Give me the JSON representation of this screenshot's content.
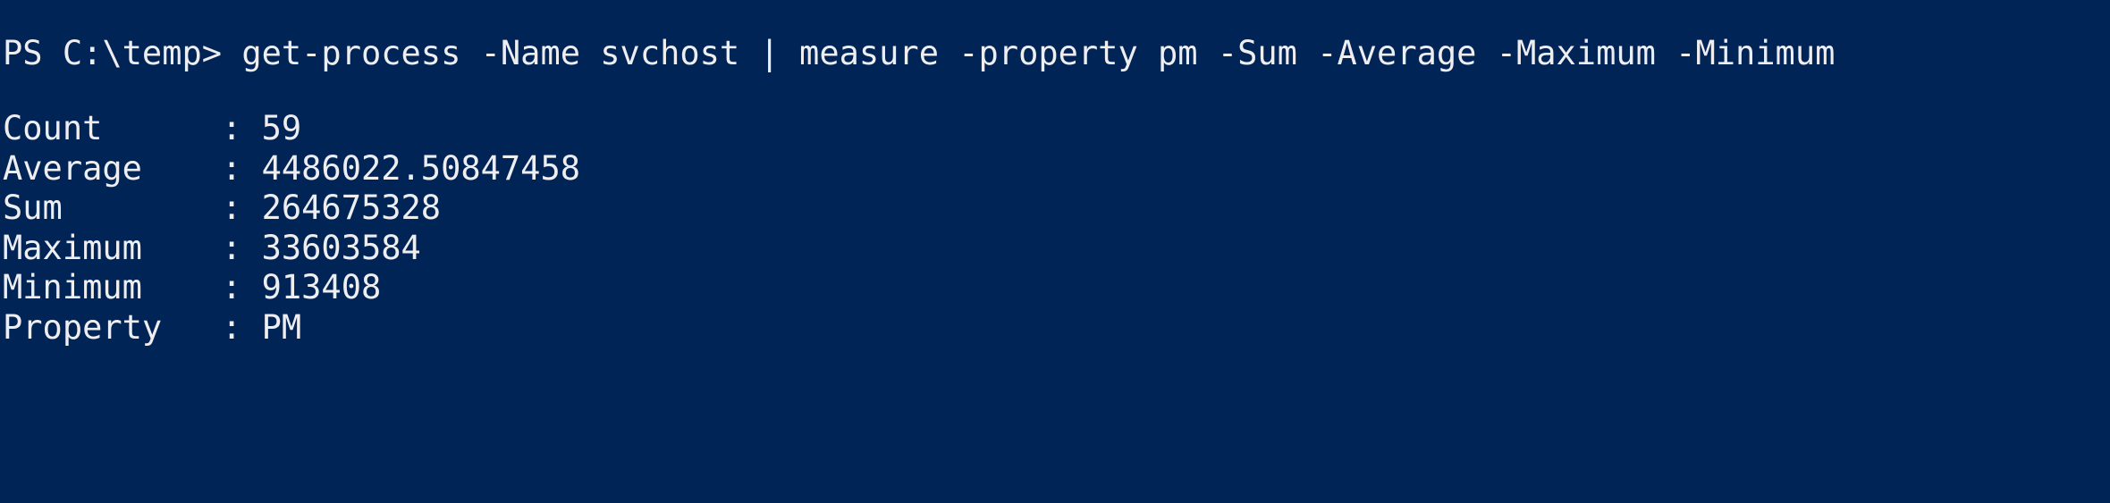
{
  "console": {
    "prompt": "PS C:\\temp> ",
    "command": "get-process -Name svchost | measure -property pm -Sum -Average -Maximum -Minimum",
    "background_color": "#012456",
    "text_color": "#eeedf0"
  },
  "results": [
    {
      "key": "Count",
      "value": "59"
    },
    {
      "key": "Average",
      "value": "4486022.50847458"
    },
    {
      "key": "Sum",
      "value": "264675328"
    },
    {
      "key": "Maximum",
      "value": "33603584"
    },
    {
      "key": "Minimum",
      "value": "913408"
    },
    {
      "key": "Property",
      "value": "PM"
    }
  ]
}
